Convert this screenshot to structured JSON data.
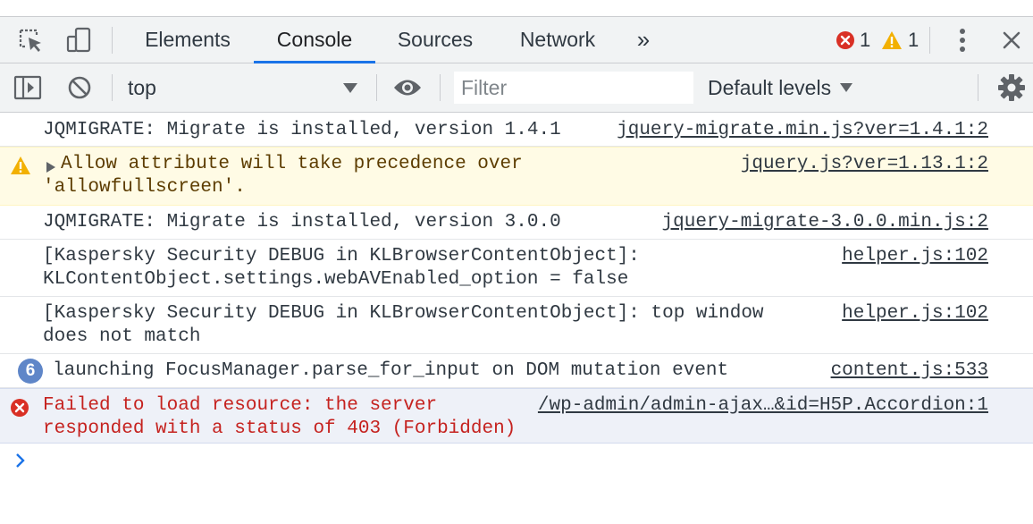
{
  "tabbar": {
    "tabs": [
      {
        "label": "Elements",
        "active": false
      },
      {
        "label": "Console",
        "active": true
      },
      {
        "label": "Sources",
        "active": false
      },
      {
        "label": "Network",
        "active": false
      }
    ],
    "more_tabs_glyph": "»",
    "error_count": "1",
    "warning_count": "1",
    "icons": [
      "inspect-element-icon",
      "device-toolbar-icon",
      "error-icon",
      "warning-icon",
      "kebab-menu-icon",
      "close-icon"
    ]
  },
  "toolbar": {
    "context": "top",
    "filter_placeholder": "Filter",
    "filter_value": "",
    "levels": "Default levels",
    "icons": [
      "show-sidebar-icon",
      "clear-console-icon",
      "chevron-down-icon",
      "eye-icon",
      "gear-icon"
    ]
  },
  "messages": [
    {
      "level": "info",
      "lines": [
        "JQMIGRATE: Migrate is installed, version 1.4.1"
      ],
      "source": "jquery-migrate.min.js?ver=1.4.1:2"
    },
    {
      "level": "warning",
      "lines": [
        "Allow attribute will take precedence over",
        "'allowfullscreen'."
      ],
      "source": "jquery.js?ver=1.13.1:2"
    },
    {
      "level": "info",
      "lines": [
        "JQMIGRATE: Migrate is installed, version 3.0.0"
      ],
      "source": "jquery-migrate-3.0.0.min.js:2"
    },
    {
      "level": "info",
      "lines": [
        "[Kaspersky Security DEBUG in KLBrowserContentObject]:",
        "KLContentObject.settings.webAVEnabled_option = false"
      ],
      "source": "helper.js:102"
    },
    {
      "level": "info",
      "lines": [
        "[Kaspersky Security DEBUG in KLBrowserContentObject]: top window",
        "does not match"
      ],
      "source": "helper.js:102"
    },
    {
      "level": "info",
      "repeat_count": "6",
      "lines": [
        "launching FocusManager.parse_for_input on DOM mutation event"
      ],
      "source": "content.js:533"
    },
    {
      "level": "error",
      "lines": [
        "Failed to load resource: the server",
        "responded with a status of 403 (Forbidden)"
      ],
      "source": "/wp-admin/admin-ajax…&id=H5P.Accordion:1"
    }
  ],
  "colors": {
    "accent": "#1a73e8",
    "error": "#d93025",
    "warning": "#f2b002",
    "error_bg": "#eef1f8",
    "warning_bg": "#fffbe5"
  }
}
